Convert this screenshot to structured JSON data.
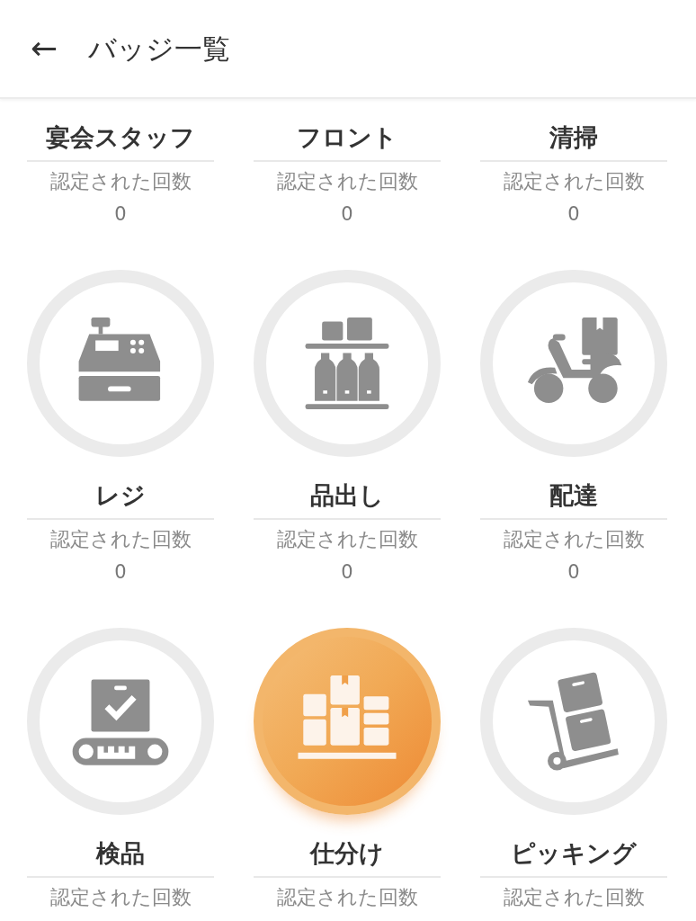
{
  "header": {
    "back": "←",
    "title": "バッジ一覧"
  },
  "badges": [
    {
      "name": "宴会スタッフ",
      "caption": "認定された回数",
      "count": "0"
    },
    {
      "name": "フロント",
      "caption": "認定された回数",
      "count": "0"
    },
    {
      "name": "清掃",
      "caption": "認定された回数",
      "count": "0"
    },
    {
      "earned": false,
      "name": "レジ",
      "caption": "認定された回数",
      "count": "0"
    },
    {
      "earned": false,
      "name": "品出し",
      "caption": "認定された回数",
      "count": "0"
    },
    {
      "earned": false,
      "name": "配達",
      "caption": "認定された回数",
      "count": "0"
    },
    {
      "earned": false,
      "name": "検品",
      "caption": "認定された回数"
    },
    {
      "earned": true,
      "name": "仕分け",
      "caption": "認定された回数"
    },
    {
      "earned": false,
      "name": "ピッキング",
      "caption": "認定された回数"
    }
  ]
}
